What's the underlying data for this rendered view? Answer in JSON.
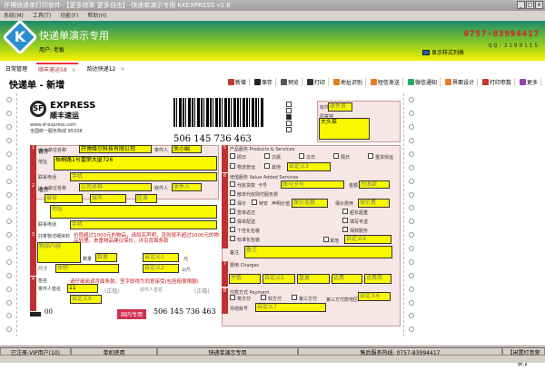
{
  "window": {
    "title": "开博快递单打印软件-【更多效率 更多自由】-快递单演示专用   KKEXPRESS v1.6",
    "controls": [
      "_",
      "□",
      "×"
    ]
  },
  "menu": [
    "系统(M)",
    "工具(T)",
    "功能(F)",
    "帮助(H)"
  ],
  "banner": {
    "logo": "K",
    "app_name": "快递单演示专用",
    "user": "用户: 老板",
    "phone": "0757-83994417",
    "qq": "QQ:3190115",
    "style_list": "显示样式列表"
  },
  "tabs": [
    {
      "label": "日常管理"
    },
    {
      "label": "顺丰速运58",
      "close": "×"
    },
    {
      "label": "韵达快递12",
      "close": "×"
    }
  ],
  "page_title": "快递单 - 新增",
  "toolbar": [
    "新增",
    "保存",
    "预览",
    "打印",
    "地址识别",
    "短信发送",
    "微信通知",
    "界面设计",
    "打印参数",
    "更多"
  ],
  "toolbar_colors": [
    "#c0392b",
    "#222",
    "#555",
    "#333",
    "#e67e22",
    "#e67e22",
    "#27ae60",
    "#e67e22",
    "#c0392b",
    "#8e44ad"
  ],
  "waybill": {
    "brand": "EXPRESS",
    "brand_cn": "顺丰速运",
    "website": "www.sf-express.com",
    "hotline": "全国统一服务热线 95338",
    "barcode_no": "506  145  736  463",
    "barcode_no_small": "506 145 736 463",
    "domestic": "国内专用",
    "footer_code": "00",
    "sender": {
      "label": "寄件",
      "company_label": "单位名称",
      "company": "开博维尔科技有限公司",
      "contact_label": "寄件人",
      "contact": "关小娟",
      "address_label": "地址",
      "address": "梧桐路1号富荣大厦726",
      "phone_label": "联系电话",
      "phone": "手机"
    },
    "receiver": {
      "label": "收件",
      "company_label": "单位名称",
      "company": "公司名称",
      "contact_label": "收件人",
      "contact": "收件人",
      "province": "省份",
      "city": "城市",
      "district": "区县",
      "address": "地址",
      "phone_label": "联系电话",
      "phone": "手机"
    },
    "goods": {
      "label": "托寄物详细资料",
      "notice": "价值超过1000元的物品，请如实声明，否则按不超过1000元的物品处理。贵重物品建议保价，详见背面条款",
      "content": "物品内容",
      "qty_label": "数量",
      "qty": "数量",
      "custom1": "自定义1",
      "size_label": "尺寸",
      "volume": "体积",
      "custom2": "自定义2",
      "unit1": "元",
      "unit2": "公斤"
    },
    "sign": {
      "label": "签名",
      "notice": "请仔细阅读背面条款，签字即视为同意接受(包括赔偿限额)",
      "sender_sign_label": "寄件人签名",
      "sender_sign": "11",
      "format": "(正楷)",
      "format2": "(正楷)",
      "receiver_sign_label": "收件人签名",
      "custom8": "自定义8"
    },
    "top_right": {
      "recipient_label": "收件员",
      "recipient": "收件员",
      "origin_label": "原寄地",
      "origin": "大头菜"
    },
    "products": {
      "label": "产品服务 Products & Services",
      "items": [
        "即日",
        "次晨",
        "次日",
        "隔日",
        "重货快运",
        "物流普运",
        "其他"
      ],
      "custom3": "自定义3"
    },
    "value_added": {
      "label": "增值服务 Value Added Services",
      "cod": "代收货款",
      "card_label": "卡号",
      "card": "账号卡号",
      "amount_label": "金额",
      "amount": "代收款",
      "items": [
        "散单代收则付服务费",
        "保价",
        "签单返还",
        "保单配送",
        "个性化包装",
        "标准化包装"
      ],
      "special": "特安",
      "declared_label": "声明价值",
      "declared": "保价金额",
      "fee_label": "保价费用",
      "fee": "保价费",
      "right_items": [
        "超长超重",
        "填写专送",
        "保鲜服务"
      ],
      "other": "其他",
      "custom4": "自定义4",
      "remark_label": "备注",
      "remark": "备注"
    },
    "charges": {
      "label": "费用 Charges",
      "fields": [
        "件数",
        "自定义5",
        "重量",
        "运费",
        "总费用"
      ]
    },
    "payment": {
      "label": "付款方式 Payment",
      "options": [
        "寄方付",
        "收方付",
        "第三方付"
      ],
      "third_label": "第三方付款地区",
      "custom6": "自定义6",
      "account_label": "月结账号",
      "custom7": "自定义7"
    }
  },
  "status": [
    "已注册-VIP用户(10)",
    "单机使用",
    "快递单演示专用",
    "售后服务热线: 0757-83994417",
    "【闲置打音荣获.】"
  ]
}
